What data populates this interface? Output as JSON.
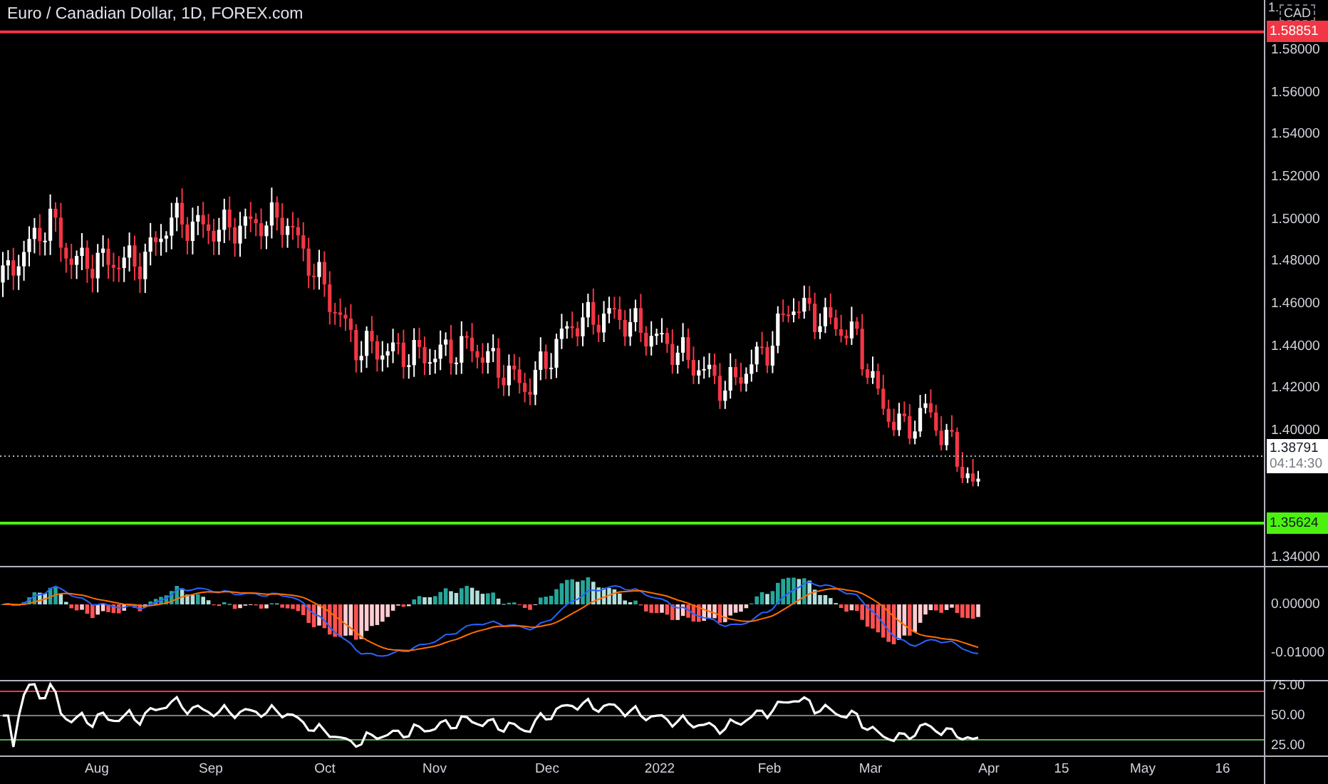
{
  "chart": {
    "title": "Euro / Canadian Dollar, 1D, FOREX.com"
  },
  "price_axis": {
    "currency": "CAD",
    "top_cut": "1.",
    "ticks": [
      "1.58000",
      "1.56000",
      "1.54000",
      "1.52000",
      "1.50000",
      "1.48000",
      "1.46000",
      "1.44000",
      "1.42000",
      "1.40000",
      "1.34000"
    ]
  },
  "price_levels": [
    {
      "label": "1.58851",
      "color": "#f23645"
    },
    {
      "label": "1.35624",
      "color": "#4cf20f"
    }
  ],
  "current_price": {
    "label": "1.38791",
    "countdown": "04:14:30"
  },
  "macd_axis": {
    "ticks": [
      "0.00000",
      "-0.01000"
    ]
  },
  "rsi_axis": {
    "ticks": [
      "75.00",
      "50.00",
      "25.00"
    ]
  },
  "time_axis": {
    "labels": [
      "Aug",
      "Sep",
      "Oct",
      "Nov",
      "Dec",
      "2022",
      "Feb",
      "Mar",
      "Apr",
      "15",
      "May",
      "16"
    ]
  }
}
